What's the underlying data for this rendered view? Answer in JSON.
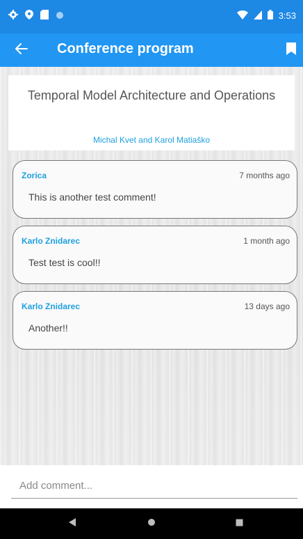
{
  "status_bar": {
    "time": "3:53",
    "icons": [
      "gear-icon",
      "location-icon",
      "sd-card-icon",
      "circle-icon",
      "wifi-icon",
      "signal-icon",
      "battery-icon"
    ]
  },
  "app_bar": {
    "title": "Conference program",
    "back_icon": "arrow-back-icon",
    "bookmark_icon": "bookmark-icon"
  },
  "paper": {
    "title": "Temporal Model Architecture and Operations",
    "authors": "Michal Kvet and Karol Matiaško"
  },
  "comments": [
    {
      "author": "Zorica",
      "time": "7 months ago",
      "text": "This is another test comment!"
    },
    {
      "author": "Karlo Znidarec",
      "time": "1 month ago",
      "text": "Test test is cool!!"
    },
    {
      "author": "Karlo Znidarec",
      "time": "13 days ago",
      "text": "Another!!"
    }
  ],
  "comment_input": {
    "placeholder": "Add comment..."
  },
  "nav_bar": {
    "icons": [
      "back-triangle-icon",
      "home-circle-icon",
      "recents-square-icon"
    ]
  },
  "colors": {
    "status_bar": "#1e88e5",
    "app_bar": "#2196f3",
    "accent": "#1ea0e0"
  }
}
